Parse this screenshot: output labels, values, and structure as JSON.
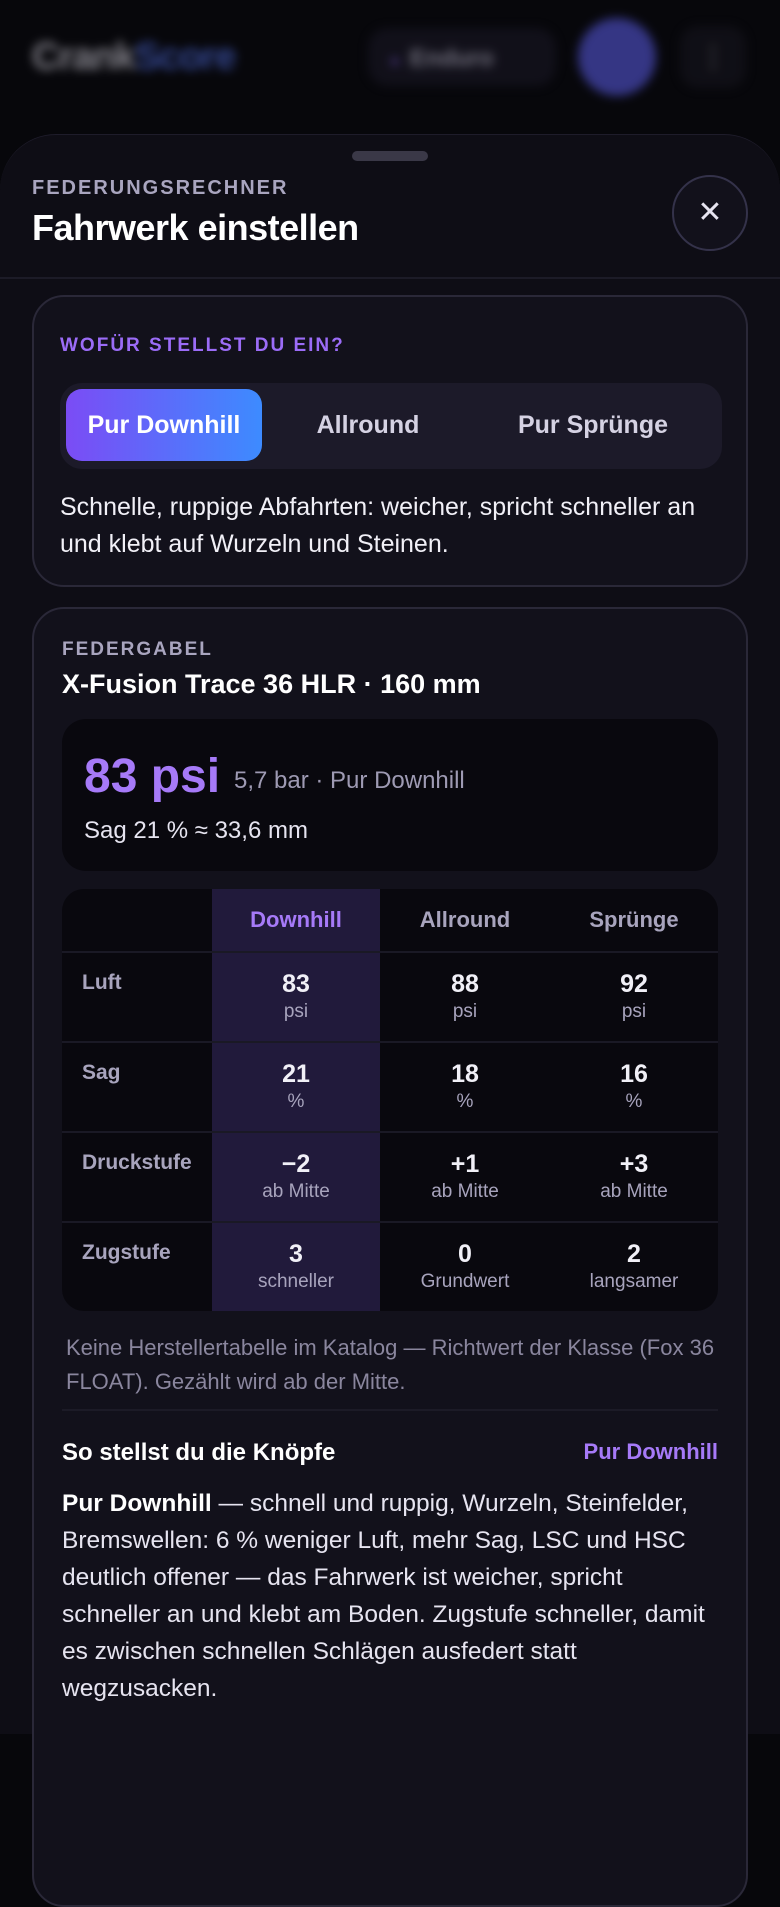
{
  "appbar": {
    "logo_a": "Crank",
    "logo_b": "Score",
    "pill_label": "Enduro",
    "more_icon": "⋮"
  },
  "sheet": {
    "eyebrow": "FEDERUNGSRECHNER",
    "title": "Fahrwerk einstellen",
    "close_icon": "✕"
  },
  "purpose": {
    "label": "WOFÜR STELLST DU EIN?",
    "options": [
      "Pur Downhill",
      "Allround",
      "Pur Sprünge"
    ],
    "selected": "Pur Downhill",
    "description": "Schnelle, ruppige Abfahrten: weicher, spricht schneller an und klebt auf Wurzeln und Steinen."
  },
  "fork": {
    "eyebrow": "FEDERGABEL",
    "name": "X-Fusion Trace 36 HLR · 160 mm",
    "result_main": "83 psi",
    "result_sub": "5,7 bar · Pur Downhill",
    "result_sag": "Sag 21 % ≈ 33,6 mm",
    "table": {
      "headers": [
        "Downhill",
        "Allround",
        "Sprünge"
      ],
      "rows": [
        {
          "label": "Luft",
          "cells": [
            {
              "v": "83",
              "u": "psi"
            },
            {
              "v": "88",
              "u": "psi"
            },
            {
              "v": "92",
              "u": "psi"
            }
          ]
        },
        {
          "label": "Sag",
          "cells": [
            {
              "v": "21",
              "u": "%"
            },
            {
              "v": "18",
              "u": "%"
            },
            {
              "v": "16",
              "u": "%"
            }
          ]
        },
        {
          "label": "Druckstufe",
          "cells": [
            {
              "v": "−2",
              "u": "ab Mitte"
            },
            {
              "v": "+1",
              "u": "ab Mitte"
            },
            {
              "v": "+3",
              "u": "ab Mitte"
            }
          ]
        },
        {
          "label": "Zugstufe",
          "cells": [
            {
              "v": "3",
              "u": "schneller"
            },
            {
              "v": "0",
              "u": "Grundwert"
            },
            {
              "v": "2",
              "u": "langsamer"
            }
          ]
        }
      ]
    },
    "footnote": "Keine Herstellertabelle im Katalog — Richtwert der Klasse (Fox 36 FLOAT). Gezählt wird ab der Mitte.",
    "knobs_title": "So stellst du die Knöpfe",
    "knobs_mode": "Pur Downhill",
    "knobs_lead": "Pur Downhill",
    "knobs_text": " — schnell und ruppig, Wurzeln, Steinfelder, Bremswellen: 6 % weniger Luft, mehr Sag, LSC und HSC deutlich offener — das Fahrwerk ist weicher, spricht schneller an und klebt am Boden. Zugstufe schneller, damit es zwischen schnellen Schlägen ausfedert statt wegzusacken."
  },
  "colors": {
    "accent": "#a67af8",
    "gradient_start": "#7b4cf5",
    "gradient_end": "#3d8bff",
    "background": "#07070b"
  }
}
